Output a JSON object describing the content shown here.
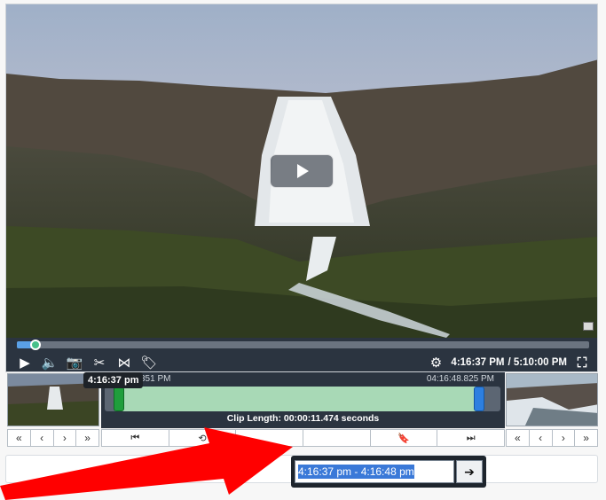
{
  "player": {
    "big_play_icon": "play-icon",
    "current_time": "4:16:37 PM",
    "total_time": "/ 5:10:00 PM",
    "progress_fraction": 0.03,
    "controls": [
      {
        "name": "play-icon",
        "glyph": "▶"
      },
      {
        "name": "volume-icon",
        "glyph": "🔈"
      },
      {
        "name": "camera-icon",
        "glyph": "📷"
      },
      {
        "name": "scissors-icon",
        "glyph": "✂"
      },
      {
        "name": "cut-range-icon",
        "glyph": "⋈"
      },
      {
        "name": "tag-icon",
        "glyph": "🏷"
      }
    ],
    "settings_icon": "⚙",
    "fullscreen_icon": "⛶"
  },
  "timeline": {
    "tooltip": "4:16:37 pm",
    "start_label": "351 PM",
    "end_label": "04:16:48.825 PM",
    "clip_length": "Clip Length: 00:00:11.474 seconds",
    "left_nav": [
      "«",
      "‹",
      "›",
      "»"
    ],
    "right_nav": [
      "«",
      "‹",
      "›",
      "»"
    ],
    "clip_buttons": [
      "⏮",
      "⟲",
      "",
      "",
      "🔖",
      "⏭"
    ]
  },
  "range": {
    "value": "4:16:37 pm - 4:16:48 pm",
    "go_icon": "➔"
  },
  "colors": {
    "annotation_arrow": "#ff0000",
    "start_handle": "#1f9e3c",
    "end_handle": "#2d7fe0",
    "clip_range": "#a8d9b6"
  }
}
